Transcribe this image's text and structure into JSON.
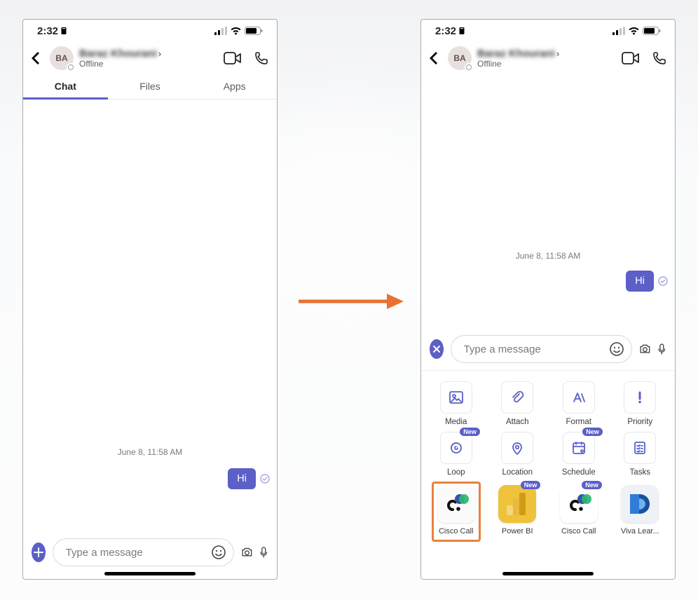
{
  "status_bar": {
    "time": "2:32"
  },
  "header": {
    "avatar_initials": "BA",
    "contact_name": "Baraz Khourani",
    "presence_text": "Offline"
  },
  "tabs": [
    {
      "label": "Chat",
      "active": true
    },
    {
      "label": "Files",
      "active": false
    },
    {
      "label": "Apps",
      "active": false
    }
  ],
  "chat": {
    "date_separator": "June 8, 11:58 AM",
    "message_text": "Hi"
  },
  "compose": {
    "placeholder": "Type a message"
  },
  "drawer_tiles": [
    {
      "label": "Media",
      "icon": "image",
      "badge": null
    },
    {
      "label": "Attach",
      "icon": "paperclip",
      "badge": null
    },
    {
      "label": "Format",
      "icon": "format",
      "badge": null
    },
    {
      "label": "Priority",
      "icon": "priority",
      "badge": null
    },
    {
      "label": "Loop",
      "icon": "loop",
      "badge": "New"
    },
    {
      "label": "Location",
      "icon": "location",
      "badge": null
    },
    {
      "label": "Schedule",
      "icon": "schedule",
      "badge": "New"
    },
    {
      "label": "Tasks",
      "icon": "tasks",
      "badge": null
    }
  ],
  "app_row": [
    {
      "label": "Cisco Call",
      "icon": "cisco",
      "bg": "#fbfbfb",
      "badge": null,
      "highlight": true
    },
    {
      "label": "Power BI",
      "icon": "powerbi",
      "bg": "#eec23b",
      "badge": "New",
      "highlight": false
    },
    {
      "label": "Cisco Call",
      "icon": "cisco",
      "bg": "#ffffff",
      "badge": "New",
      "highlight": false
    },
    {
      "label": "Viva Lear...",
      "icon": "viva",
      "bg": "#eef1f5",
      "badge": null,
      "highlight": false
    }
  ],
  "badge_text": "New"
}
